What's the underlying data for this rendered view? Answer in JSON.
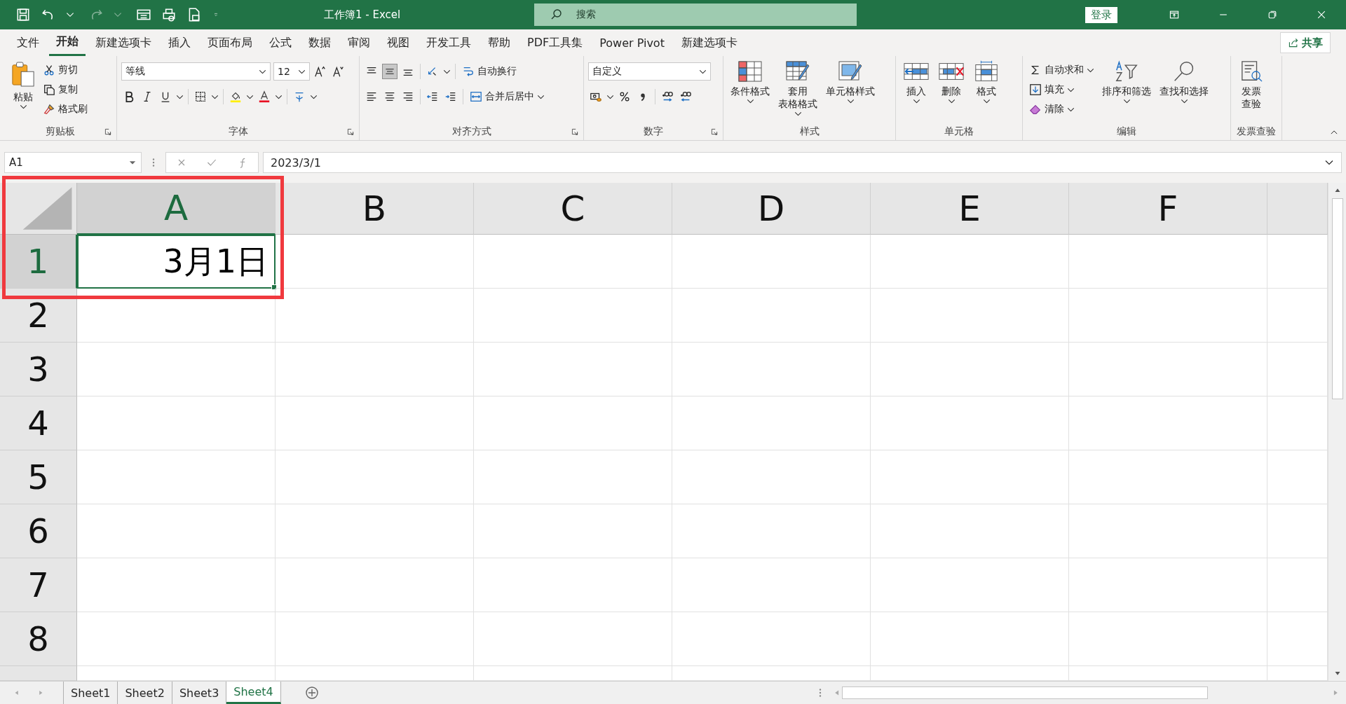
{
  "window": {
    "title": "工作簿1  -  Excel"
  },
  "search": {
    "placeholder": "搜索"
  },
  "account": {
    "sign_in": "登录"
  },
  "tabs": [
    {
      "label": "文件",
      "selected": false
    },
    {
      "label": "开始",
      "selected": true
    },
    {
      "label": "新建选项卡",
      "selected": false
    },
    {
      "label": "插入",
      "selected": false
    },
    {
      "label": "页面布局",
      "selected": false
    },
    {
      "label": "公式",
      "selected": false
    },
    {
      "label": "数据",
      "selected": false
    },
    {
      "label": "审阅",
      "selected": false
    },
    {
      "label": "视图",
      "selected": false
    },
    {
      "label": "开发工具",
      "selected": false
    },
    {
      "label": "帮助",
      "selected": false
    },
    {
      "label": "PDF工具集",
      "selected": false
    },
    {
      "label": "Power Pivot",
      "selected": false
    },
    {
      "label": "新建选项卡",
      "selected": false
    }
  ],
  "share": {
    "label": "共享"
  },
  "ribbon": {
    "clipboard": {
      "label": "剪贴板",
      "paste": "粘贴",
      "actions": [
        "剪切",
        "复制",
        "格式刷"
      ]
    },
    "font": {
      "label": "字体",
      "font_name": "等线",
      "font_size": "12"
    },
    "alignment": {
      "label": "对齐方式",
      "vertical": [
        {
          "selected": false
        },
        {
          "selected": true
        },
        {
          "selected": false
        }
      ],
      "wrap": "自动换行",
      "merge": "合并后居中"
    },
    "number": {
      "label": "数字",
      "format": "自定义"
    },
    "styles": {
      "label": "样式",
      "buttons": [
        {
          "lines": [
            "条件格式"
          ]
        },
        {
          "lines": [
            "套用",
            "表格格式"
          ]
        },
        {
          "lines": [
            "单元格样式"
          ]
        }
      ]
    },
    "cells": {
      "label": "单元格",
      "buttons": [
        "插入",
        "删除",
        "格式"
      ]
    },
    "editing": {
      "label": "编辑",
      "small": [
        "自动求和",
        "填充",
        "清除"
      ],
      "large": [
        "排序和筛选",
        "查找和选择"
      ]
    },
    "invoice": {
      "label": "发票查验",
      "button": [
        "发票",
        "查验"
      ]
    }
  },
  "formula_bar": {
    "name_box": "A1",
    "formula": "2023/3/1"
  },
  "sheet": {
    "columns": [
      {
        "label": "A",
        "selected": true
      },
      {
        "label": "B",
        "selected": false
      },
      {
        "label": "C",
        "selected": false
      },
      {
        "label": "D",
        "selected": false
      },
      {
        "label": "E",
        "selected": false
      },
      {
        "label": "F",
        "selected": false
      }
    ],
    "rows": [
      {
        "label": "1",
        "selected": true,
        "cells": [
          {
            "value": "3月1日",
            "active": true
          }
        ]
      },
      {
        "label": "2",
        "selected": false
      },
      {
        "label": "3",
        "selected": false
      },
      {
        "label": "4",
        "selected": false
      },
      {
        "label": "5",
        "selected": false
      },
      {
        "label": "6",
        "selected": false
      },
      {
        "label": "7",
        "selected": false
      },
      {
        "label": "8",
        "selected": false
      }
    ]
  },
  "sheet_tabs": [
    {
      "label": "Sheet1",
      "selected": false
    },
    {
      "label": "Sheet2",
      "selected": false
    },
    {
      "label": "Sheet3",
      "selected": false
    },
    {
      "label": "Sheet4",
      "selected": true
    }
  ],
  "annotation": {
    "kind": "frame"
  }
}
